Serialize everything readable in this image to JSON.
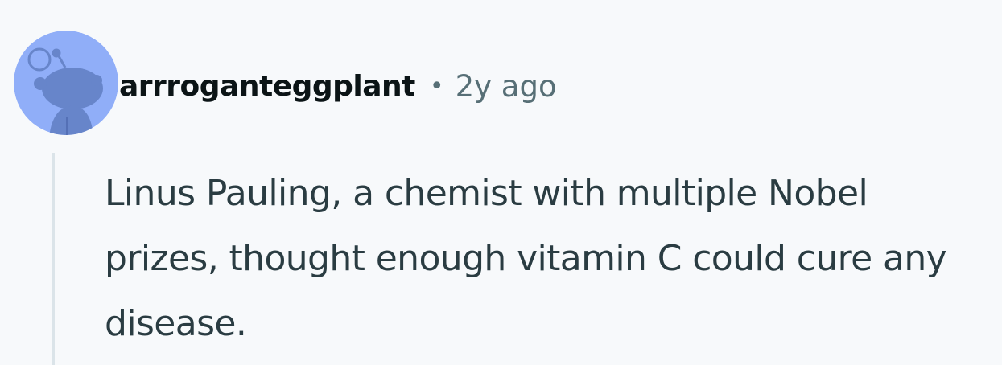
{
  "comment": {
    "author": "arrroganteggplant",
    "separator": "•",
    "age": "2y ago",
    "body": "Linus Pauling, a chemist with multiple Nobel prizes, thought enough vitamin C could cure any disease.",
    "avatar_icon": "snoo-avatar-icon"
  },
  "colors": {
    "background": "#f7f9fb",
    "avatar_bg": "#90aef8",
    "avatar_figure": "#6785ca",
    "username": "#0b1416",
    "meta": "#576f76",
    "body": "#2a3c42",
    "thread_line": "#dbe4e9"
  }
}
